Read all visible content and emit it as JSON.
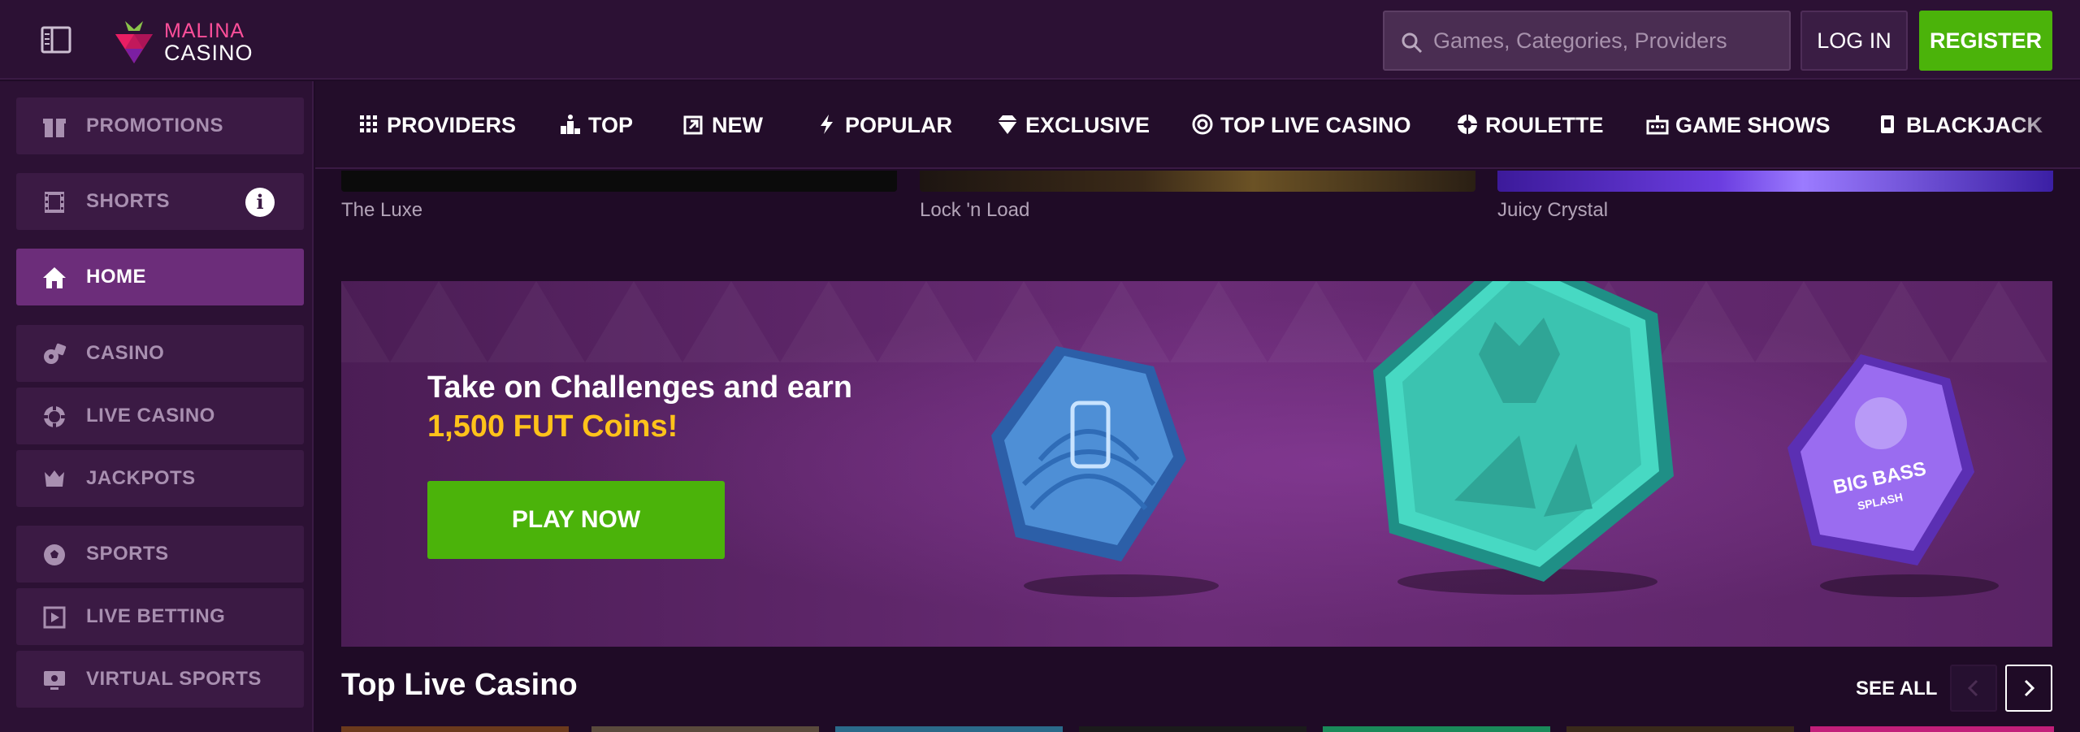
{
  "header": {
    "logo_top": "MALINA",
    "logo_bottom": "CASINO",
    "search_placeholder": "Games, Categories, Providers",
    "login_label": "LOG IN",
    "register_label": "REGISTER"
  },
  "sidebar": {
    "items": [
      {
        "label": "PROMOTIONS",
        "icon": "gift-icon"
      },
      {
        "label": "SHORTS",
        "icon": "film-icon",
        "badge": "i"
      },
      {
        "label": "HOME",
        "icon": "home-icon",
        "active": true
      },
      {
        "label": "CASINO",
        "icon": "dice-icon"
      },
      {
        "label": "LIVE CASINO",
        "icon": "chip-icon"
      },
      {
        "label": "JACKPOTS",
        "icon": "crown-icon"
      },
      {
        "label": "SPORTS",
        "icon": "soccer-ball-icon"
      },
      {
        "label": "LIVE BETTING",
        "icon": "live-betting-icon"
      },
      {
        "label": "VIRTUAL SPORTS",
        "icon": "monitor-icon"
      }
    ]
  },
  "categories": [
    {
      "label": "PROVIDERS",
      "icon": "grid-icon"
    },
    {
      "label": "TOP",
      "icon": "podium-icon"
    },
    {
      "label": "NEW",
      "icon": "new-icon"
    },
    {
      "label": "POPULAR",
      "icon": "lightning-icon"
    },
    {
      "label": "EXCLUSIVE",
      "icon": "diamond-icon"
    },
    {
      "label": "TOP LIVE CASINO",
      "icon": "chip-icon"
    },
    {
      "label": "ROULETTE",
      "icon": "roulette-icon"
    },
    {
      "label": "GAME SHOWS",
      "icon": "game-show-icon"
    },
    {
      "label": "BLACKJACK",
      "icon": "cards-icon"
    }
  ],
  "games": [
    {
      "label": "The Luxe"
    },
    {
      "label": "Lock 'n Load"
    },
    {
      "label": "Juicy Crystal"
    }
  ],
  "banner": {
    "line1": "Take on Challenges and earn",
    "line2": "1,500 FUT Coins!",
    "cta": "PLAY NOW",
    "badge_right_line1": "BIG BASS",
    "badge_right_line2": "SPLASH"
  },
  "section": {
    "title": "Top Live Casino",
    "see_all": "SEE ALL"
  },
  "colors": {
    "accent_green": "#4bb30a",
    "highlight_yellow": "#ffc21a",
    "brand_pink": "#ff4f9a",
    "panel": "#2c1134",
    "background": "#1f0b26"
  }
}
